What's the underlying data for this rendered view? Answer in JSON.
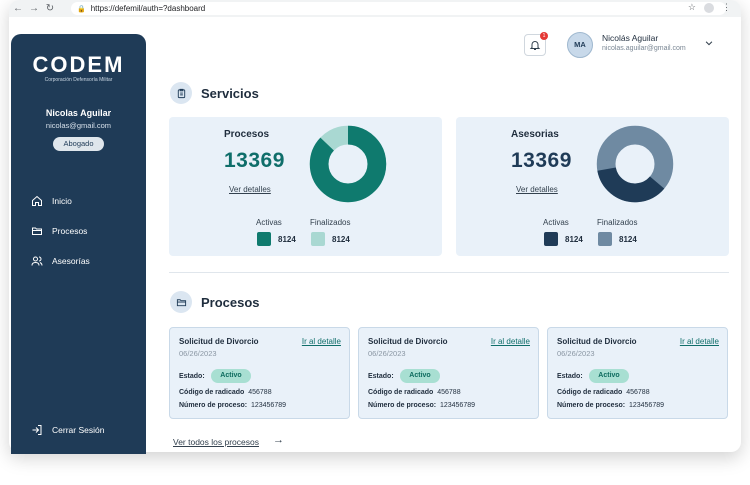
{
  "browser": {
    "url": "https://defemil/auth=?dashboard"
  },
  "sidebar": {
    "logo": "CODEM",
    "logo_subtitle": "Corporación Defensoría Militar",
    "user_name": "Nicolas Aguilar",
    "user_email": "nicolas@gmail.com",
    "role": "Abogado",
    "items": [
      {
        "label": "Inicio",
        "icon": "home-icon"
      },
      {
        "label": "Procesos",
        "icon": "folder-icon"
      },
      {
        "label": "Asesorías",
        "icon": "users-icon"
      }
    ],
    "logout_label": "Cerrar Sesión"
  },
  "header": {
    "notification_count": "1",
    "avatar_initials": "MA",
    "user_name": "Nicolás Aguilar",
    "user_email": "nicolas.aguilar@gmail.com"
  },
  "services": {
    "title": "Servicios",
    "cards": [
      {
        "title": "Procesos",
        "value": "13369",
        "link": "Ver detalles",
        "legend": [
          {
            "label": "Activas",
            "value": "8124"
          },
          {
            "label": "Finalizados",
            "value": "8124"
          }
        ],
        "colors": {
          "primary": "#0f7a6e",
          "secondary": "#a9d8d2",
          "value_color": "#0f6e6a"
        },
        "donut_fraction_primary": 0.87
      },
      {
        "title": "Asesorias",
        "value": "13369",
        "link": "Ver detalles",
        "legend": [
          {
            "label": "Activas",
            "value": "8124"
          },
          {
            "label": "Finalizados",
            "value": "8124"
          }
        ],
        "colors": {
          "primary": "#1f3b57",
          "secondary": "#6f8aa2",
          "value_color": "#1f3b57"
        },
        "donut_fraction_primary": 0.36
      }
    ]
  },
  "processes": {
    "title": "Procesos",
    "cards": [
      {
        "title": "Solicitud de Divorcio",
        "link": "Ir al detalle",
        "date": "06/26/2023",
        "estado_label": "Estado:",
        "estado": "Activo",
        "radicado_label": "Código de radicado",
        "radicado": "456788",
        "numero_label": "Número de proceso:",
        "numero": "123456789"
      },
      {
        "title": "Solicitud de Divorcio",
        "link": "Ir al detalle",
        "date": "06/26/2023",
        "estado_label": "Estado:",
        "estado": "Activo",
        "radicado_label": "Código de radicado",
        "radicado": "456788",
        "numero_label": "Número de proceso:",
        "numero": "123456789"
      },
      {
        "title": "Solicitud de Divorcio",
        "link": "Ir al detalle",
        "date": "06/26/2023",
        "estado_label": "Estado:",
        "estado": "Activo",
        "radicado_label": "Código de radicado",
        "radicado": "456788",
        "numero_label": "Número de proceso:",
        "numero": "123456789"
      }
    ],
    "see_all": "Ver todos los procesos"
  }
}
